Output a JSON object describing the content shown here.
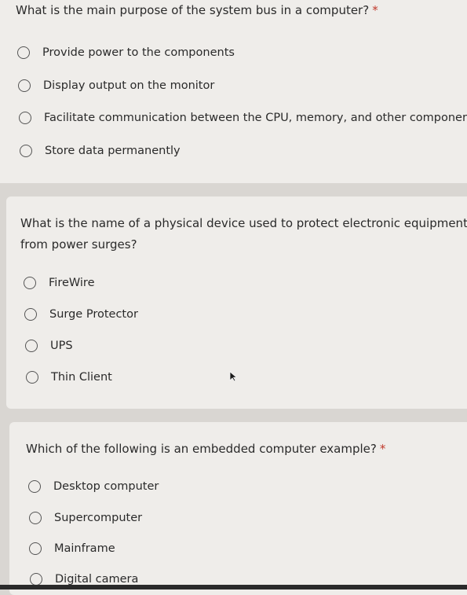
{
  "questions": [
    {
      "text": "What is the main purpose of the system bus in a computer?",
      "required_marker": "*",
      "options": [
        "Provide power to the components",
        "Display output on the monitor",
        "Facilitate communication between the CPU, memory, and other componer",
        "Store data permanently"
      ]
    },
    {
      "text_line1": "What is the name of a physical device used to protect electronic equipment",
      "text_line2": "from power surges?",
      "options": [
        "FireWire",
        "Surge Protector",
        "UPS",
        "Thin Client"
      ]
    },
    {
      "text": "Which of the following is an embedded computer example?",
      "required_marker": "*",
      "options": [
        "Desktop computer",
        "Supercomputer",
        "Mainframe",
        "Digital camera"
      ]
    }
  ],
  "icons": {
    "cursor": "mouse-pointer-icon",
    "radio": "radio-unselected-icon"
  }
}
